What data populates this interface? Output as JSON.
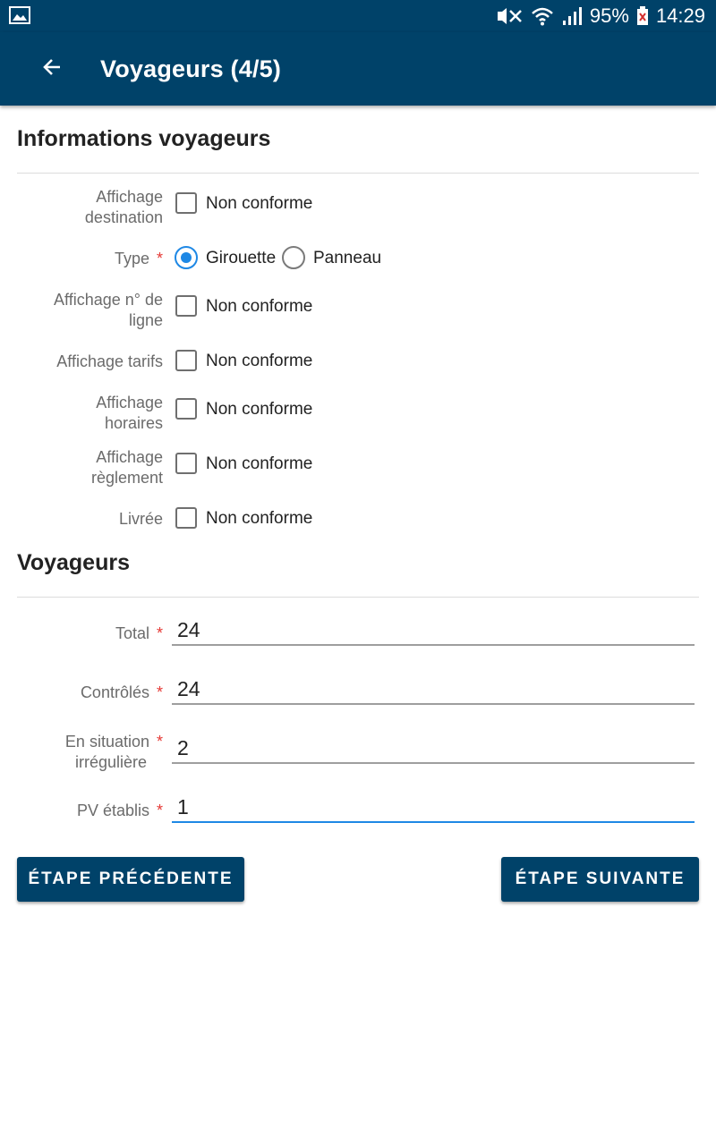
{
  "status_bar": {
    "battery": "95%",
    "time": "14:29",
    "icons": [
      "gallery-icon",
      "mute-icon",
      "wifi-icon",
      "signal-icon",
      "battery-icon"
    ]
  },
  "app_bar": {
    "title": "Voyageurs (4/5)",
    "back_icon": "arrow-left-icon"
  },
  "info_section": {
    "title": "Informations voyageurs",
    "rows": [
      {
        "label_line1": "Affichage",
        "label_line2": "destination",
        "checkbox_label": "Non conforme",
        "checked": false
      },
      {
        "label": "Type",
        "required": "*",
        "options": [
          "Girouette",
          "Panneau"
        ],
        "selected": "Girouette"
      },
      {
        "label_line1": "Affichage n° de",
        "label_line2": "ligne",
        "checkbox_label": "Non conforme",
        "checked": false
      },
      {
        "label": "Affichage tarifs",
        "checkbox_label": "Non conforme",
        "checked": false
      },
      {
        "label_line1": "Affichage",
        "label_line2": "horaires",
        "checkbox_label": "Non conforme",
        "checked": false
      },
      {
        "label_line1": "Affichage",
        "label_line2": "règlement",
        "checkbox_label": "Non conforme",
        "checked": false
      },
      {
        "label": "Livrée",
        "checkbox_label": "Non conforme",
        "checked": false
      }
    ]
  },
  "voyageurs_section": {
    "title": "Voyageurs",
    "fields": [
      {
        "label": "Total",
        "required": "*",
        "value": "24"
      },
      {
        "label": "Contrôlés",
        "required": "*",
        "value": "24"
      },
      {
        "label_line1": "En situation",
        "label_line2": "irrégulière",
        "required": "*",
        "value": "2"
      },
      {
        "label": "PV établis",
        "required": "*",
        "value": "1",
        "focused": true
      }
    ]
  },
  "buttons": {
    "previous": "ÉTAPE PRÉCÉDENTE",
    "next": "ÉTAPE SUIVANTE"
  },
  "colors": {
    "primary": "#004269",
    "accent": "#1e88e5",
    "required": "#e53935"
  }
}
